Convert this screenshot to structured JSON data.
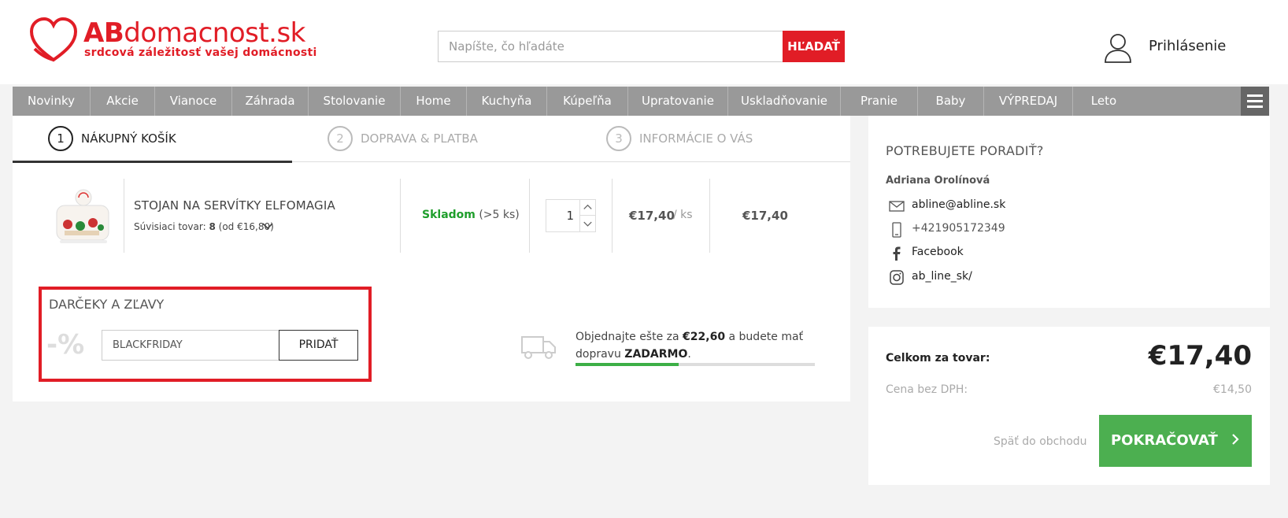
{
  "header": {
    "logo_ab": "AB",
    "logo_rest": "domacnost.sk",
    "logo_tagline": "srdcová záležitosť vašej domácnosti",
    "search_placeholder": "Napíšte, čo hľadáte",
    "search_button": "HĽADAŤ",
    "login": "Prihlásenie"
  },
  "nav": {
    "items": [
      "Novinky",
      "Akcie",
      "Vianoce",
      "Záhrada",
      "Stolovanie",
      "Home",
      "Kuchyňa",
      "Kúpeľňa",
      "Upratovanie",
      "Uskladňovanie",
      "Pranie",
      "Baby",
      "VÝPREDAJ",
      "Leto"
    ]
  },
  "steps": [
    {
      "num": "1",
      "label": "NÁKUPNÝ KOŠÍK"
    },
    {
      "num": "2",
      "label": "DOPRAVA & PLATBA"
    },
    {
      "num": "3",
      "label": "INFORMÁCIE O VÁS"
    }
  ],
  "cart": {
    "item": {
      "name": "STOJAN NA SERVÍTKY ELFOMAGIA",
      "related_prefix": "Súvisiaci tovar:",
      "related_count": "8",
      "related_suffix": "(od €16,80)",
      "stock_status": "Skladom",
      "stock_qty": "(>5 ks)",
      "quantity": "1",
      "unit_price": "€17,40",
      "unit_per": "/ ks",
      "total": "€17,40"
    }
  },
  "gifts": {
    "title": "DARČEKY A ZĽAVY",
    "percent": "-%",
    "coupon_value": "BLACKFRIDAY",
    "add_button": "PRIDAŤ"
  },
  "shipping": {
    "text_before": "Objednajte ešte za",
    "amount": "€22,60",
    "text_middle": "a budete mať dopravu",
    "free": "ZADARMO",
    "text_end": ".",
    "progress": 0.43
  },
  "help": {
    "title": "POTREBUJETE PORADIŤ?",
    "name": "Adriana Orolínová",
    "email": "abline@abline.sk",
    "phone": "+421905172349",
    "facebook": "Facebook",
    "instagram": "ab_line_sk/"
  },
  "summary": {
    "total_label": "Celkom za tovar:",
    "total_value": "€17,40",
    "nodph_label": "Cena bez DPH:",
    "nodph_value": "€14,50",
    "back_link": "Späť do obchodu",
    "continue_button": "POKRAČOVAŤ"
  },
  "colors": {
    "brand_red": "#e11d26",
    "nav_gray": "#999999",
    "stock_green": "#1e9e2b",
    "continue_green": "#4caf50"
  }
}
